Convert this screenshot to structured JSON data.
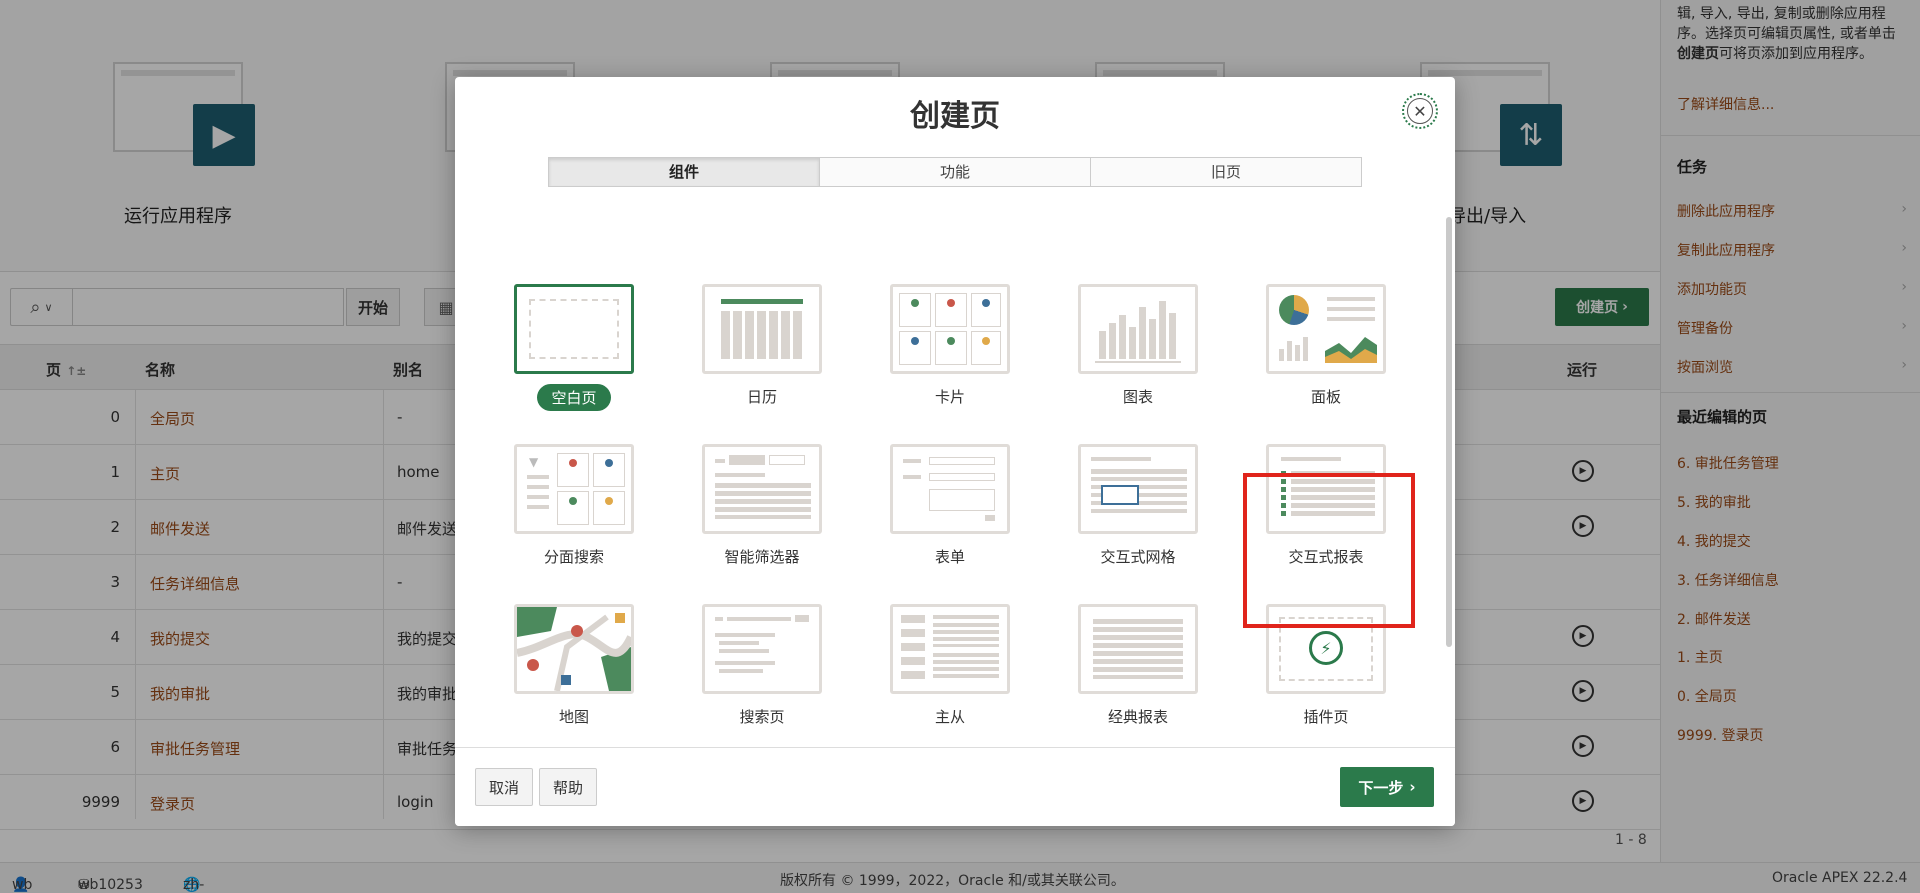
{
  "hero": {
    "run_label": "运行应用程序",
    "export_label": "导出/导入"
  },
  "toolbar": {
    "start_button": "开始",
    "create_page_button": "创建页"
  },
  "table": {
    "headers": {
      "page": "页",
      "name": "名称",
      "alias": "别名",
      "run": "运行"
    },
    "rows": [
      {
        "id": "0",
        "name": "全局页",
        "alias": "-"
      },
      {
        "id": "1",
        "name": "主页",
        "alias": "home"
      },
      {
        "id": "2",
        "name": "邮件发送",
        "alias": "邮件发送"
      },
      {
        "id": "3",
        "name": "任务详细信息",
        "alias": "-"
      },
      {
        "id": "4",
        "name": "我的提交",
        "alias": "我的提交"
      },
      {
        "id": "5",
        "name": "我的审批",
        "alias": "我的审批"
      },
      {
        "id": "6",
        "name": "审批任务管理",
        "alias": "审批任务"
      },
      {
        "id": "9999",
        "name": "登录页",
        "alias": "login"
      }
    ],
    "pagination": "1 - 8"
  },
  "sidebar": {
    "intro_text": "辑, 导入, 导出, 复制或删除应用程序。选择页可编辑页属性, 或者单击",
    "intro_bold": "创建页",
    "intro_tail": "可将页添加到应用程序。",
    "learn_more": "了解详细信息...",
    "tasks_heading": "任务",
    "tasks": [
      "删除此应用程序",
      "复制此应用程序",
      "添加功能页",
      "管理备份",
      "按面浏览"
    ],
    "recent_heading": "最近编辑的页",
    "recent": [
      "6. 审批任务管理",
      "5. 我的审批",
      "4. 我的提交",
      "3. 任务详细信息",
      "2. 邮件发送",
      "1. 主页",
      "0. 全局页",
      "9999. 登录页"
    ]
  },
  "footer": {
    "user": "wb",
    "workspace": "wb10253",
    "language": "zh-cn",
    "copyright": "版权所有 © 1999，2022，Oracle 和/或其关联公司。",
    "version": "Oracle APEX 22.2.4"
  },
  "dialog": {
    "title": "创建页",
    "tabs": [
      "组件",
      "功能",
      "旧页"
    ],
    "active_tab": "组件",
    "tiles": [
      "空白页",
      "日历",
      "卡片",
      "图表",
      "面板",
      "分面搜索",
      "智能筛选器",
      "表单",
      "交互式网格",
      "交互式报表",
      "地图",
      "搜索页",
      "主从",
      "经典报表",
      "插件页"
    ],
    "selected_tile": "空白页",
    "highlighted_tile": "交互式报表",
    "cancel_button": "取消",
    "help_button": "帮助",
    "next_button": "下一步"
  },
  "colors": {
    "accent_green": "#2b7a4b",
    "link_brown": "#9c4b17",
    "highlight_red": "#e0241b",
    "hero_teal": "#1e5f70"
  }
}
